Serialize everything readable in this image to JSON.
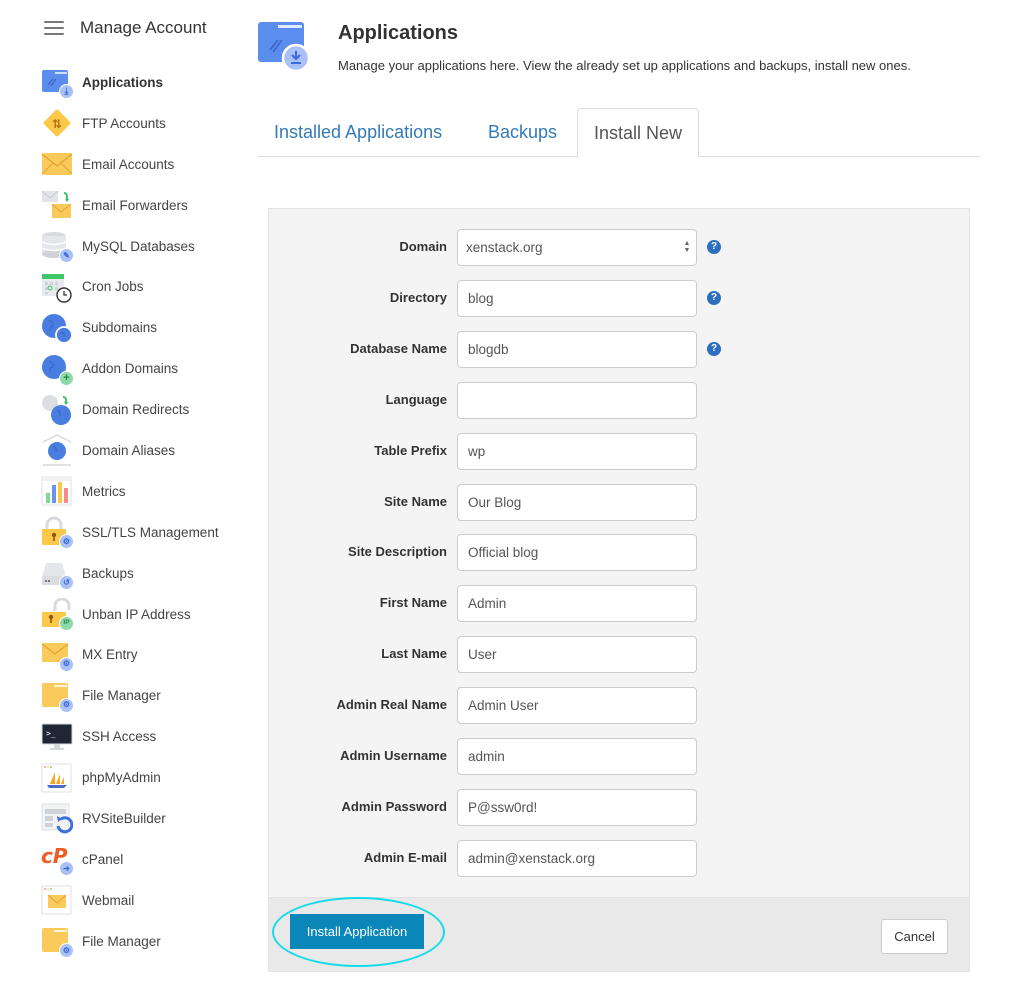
{
  "sidebar": {
    "title": "Manage Account",
    "items": [
      {
        "label": "Applications",
        "icon": "applications-icon",
        "active": true
      },
      {
        "label": "FTP Accounts",
        "icon": "ftp-icon"
      },
      {
        "label": "Email Accounts",
        "icon": "email-icon"
      },
      {
        "label": "Email Forwarders",
        "icon": "email-forwarder-icon"
      },
      {
        "label": "MySQL Databases",
        "icon": "database-icon"
      },
      {
        "label": "Cron Jobs",
        "icon": "cron-calendar-icon"
      },
      {
        "label": "Subdomains",
        "icon": "subdomain-globe-icon"
      },
      {
        "label": "Addon Domains",
        "icon": "addon-domain-globe-icon"
      },
      {
        "label": "Domain Redirects",
        "icon": "domain-redirect-icon"
      },
      {
        "label": "Domain Aliases",
        "icon": "domain-alias-icon"
      },
      {
        "label": "Metrics",
        "icon": "metrics-chart-icon"
      },
      {
        "label": "SSL/TLS Management",
        "icon": "ssl-lock-icon"
      },
      {
        "label": "Backups",
        "icon": "backup-drive-icon"
      },
      {
        "label": "Unban IP Address",
        "icon": "unban-ip-lock-icon"
      },
      {
        "label": "MX Entry",
        "icon": "mx-entry-icon"
      },
      {
        "label": "File Manager",
        "icon": "file-manager-folder-icon"
      },
      {
        "label": "SSH Access",
        "icon": "ssh-terminal-icon"
      },
      {
        "label": "phpMyAdmin",
        "icon": "phpmyadmin-sailboat-icon"
      },
      {
        "label": "RVSiteBuilder",
        "icon": "rvsitebuilder-icon"
      },
      {
        "label": "cPanel",
        "icon": "cpanel-logo-icon"
      },
      {
        "label": "Webmail",
        "icon": "webmail-icon"
      },
      {
        "label": "File Manager",
        "icon": "file-manager-folder-icon"
      }
    ]
  },
  "header": {
    "title": "Applications",
    "description": "Manage your applications here. View the already set up applications and backups, install new ones."
  },
  "tabs": [
    {
      "label": "Installed Applications",
      "active": false
    },
    {
      "label": "Backups",
      "active": false
    },
    {
      "label": "Install New",
      "active": true
    }
  ],
  "form": {
    "domain": {
      "label": "Domain",
      "value": "xenstack.org",
      "help": "?"
    },
    "fields": [
      {
        "label": "Directory",
        "value": "blog",
        "help": true
      },
      {
        "label": "Database Name",
        "value": "blogdb",
        "help": true
      },
      {
        "label": "Language",
        "value": "",
        "help": false
      },
      {
        "label": "Table Prefix",
        "value": "wp",
        "help": false
      },
      {
        "label": "Site Name",
        "value": "Our Blog",
        "help": false
      },
      {
        "label": "Site Description",
        "value": "Official blog",
        "help": false
      },
      {
        "label": "First Name",
        "value": "Admin",
        "help": false
      },
      {
        "label": "Last Name",
        "value": "User",
        "help": false
      },
      {
        "label": "Admin Real Name",
        "value": "Admin User",
        "help": false
      },
      {
        "label": "Admin Username",
        "value": "admin",
        "help": false
      },
      {
        "label": "Admin Password",
        "value": "P@ssw0rd!",
        "help": false
      },
      {
        "label": "Admin E-mail",
        "value": "admin@xenstack.org",
        "help": false
      }
    ],
    "help_glyph": "?",
    "install_label": "Install Application",
    "cancel_label": "Cancel"
  },
  "colors": {
    "link": "#337ab7",
    "primary_button": "#0a87b8",
    "highlight_ring": "#14dbe9",
    "help_icon": "#2d6fbf"
  }
}
